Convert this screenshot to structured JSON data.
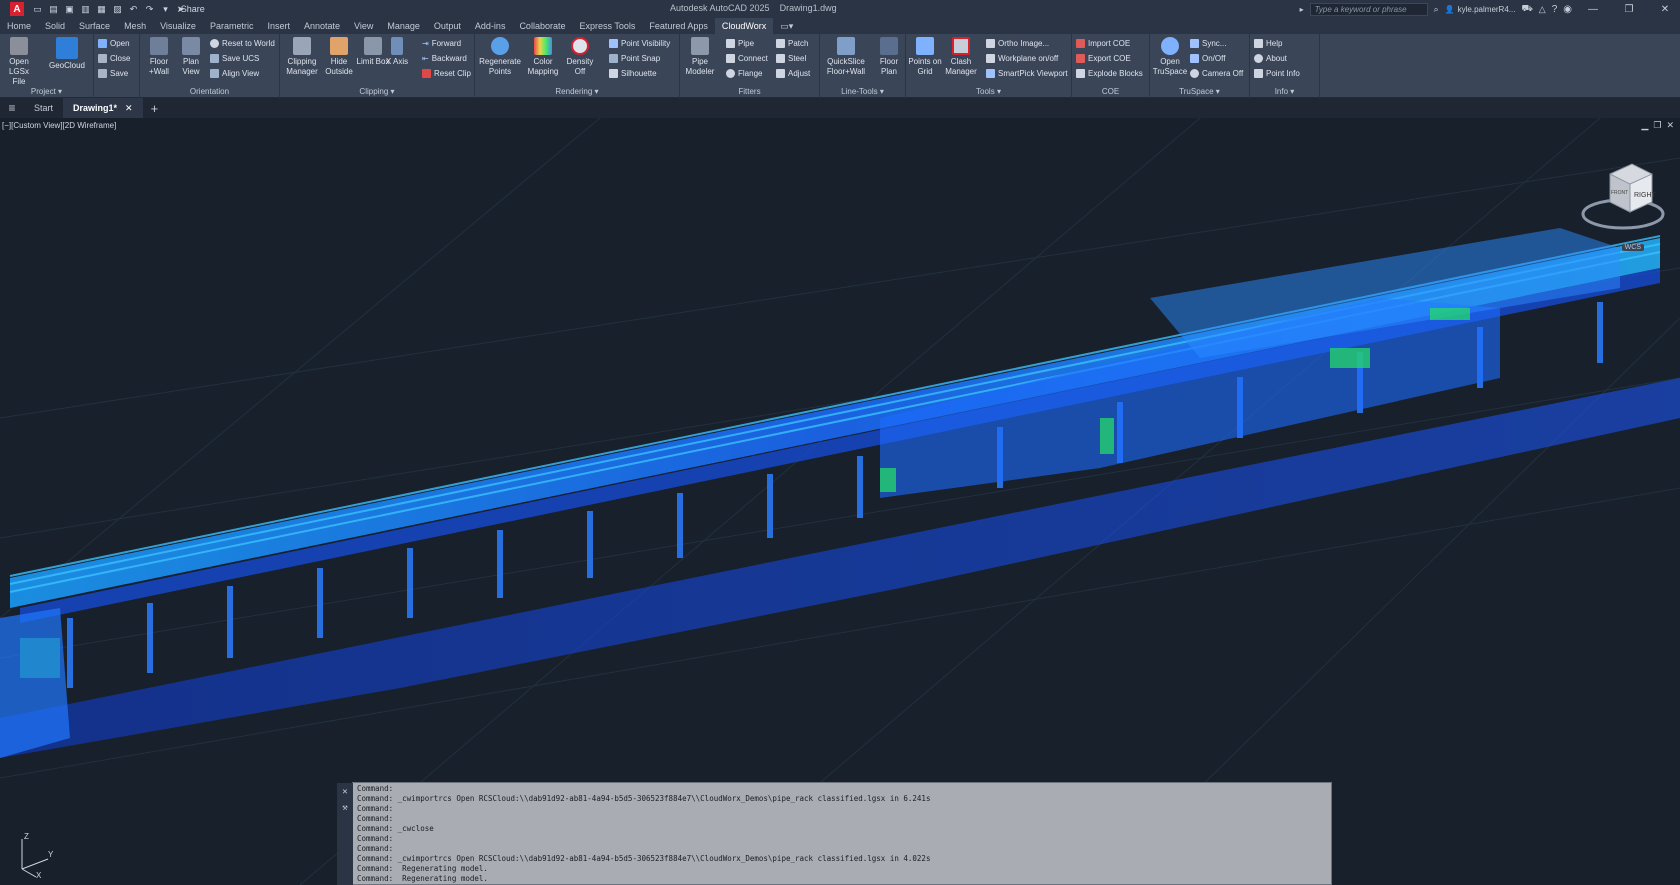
{
  "window": {
    "app_title": "Autodesk AutoCAD 2025",
    "doc_title": "Drawing1.dwg",
    "share_label": "Share",
    "search_placeholder": "Type a keyword or phrase",
    "user": "kyle.palmerR4...",
    "logo_letter": "A"
  },
  "menu_tabs": [
    "Home",
    "Solid",
    "Surface",
    "Mesh",
    "Visualize",
    "Parametric",
    "Insert",
    "Annotate",
    "View",
    "Manage",
    "Output",
    "Add-ins",
    "Collaborate",
    "Express Tools",
    "Featured Apps",
    "CloudWorx"
  ],
  "active_menu_tab": "CloudWorx",
  "ribbon": {
    "project": {
      "title": "Project",
      "open_lgsx": "Open LGSx File",
      "geocloud": "GeoCloud",
      "open": "Open",
      "close": "Close",
      "save": "Save"
    },
    "orientation": {
      "title": "Orientation",
      "floor_wall": "Floor +Wall",
      "plan_view": "Plan View",
      "reset_world": "Reset to World",
      "save_ucs": "Save UCS",
      "align_view": "Align View"
    },
    "clipping": {
      "title": "Clipping",
      "clipping_manager": "Clipping Manager",
      "hide_outside": "Hide Outside",
      "limit_box": "Limit Box",
      "x_axis": "X Axis",
      "forward": "Forward",
      "backward": "Backward",
      "reset_clip": "Reset Clip"
    },
    "rendering": {
      "title": "Rendering",
      "regenerate_points": "Regenerate Points",
      "color_mapping": "Color Mapping",
      "density_off": "Density Off",
      "point_visibility": "Point Visibility",
      "point_snap": "Point Snap",
      "silhouette": "Silhouette"
    },
    "fitters": {
      "title": "Fitters",
      "pipe_modeler": "Pipe Modeler",
      "pipe": "Pipe",
      "connect": "Connect",
      "flange": "Flange",
      "patch": "Patch",
      "steel": "Steel",
      "adjust": "Adjust"
    },
    "line_tools": {
      "title": "Line-Tools",
      "quickslice": "QuickSlice Floor+Wall",
      "floor_plan": "Floor Plan"
    },
    "tools": {
      "title": "Tools",
      "points_on_grid": "Points on Grid",
      "clash_manager": "Clash Manager",
      "ortho_image": "Ortho Image...",
      "workplane": "Workplane on/off",
      "smartpick": "SmartPick Viewport"
    },
    "coe": {
      "title": "COE",
      "import_coe": "Import COE",
      "export_coe": "Export COE",
      "explode_blocks": "Explode Blocks"
    },
    "truspace": {
      "title": "TruSpace",
      "open_truspace": "Open TruSpace",
      "sync": "Sync...",
      "on_off": "On/Off",
      "camera_off": "Camera Off"
    },
    "info": {
      "title": "Info",
      "help": "Help",
      "about": "About",
      "point_info": "Point Info"
    }
  },
  "file_tabs": {
    "start": "Start",
    "drawing": "Drawing1*"
  },
  "viewport": {
    "label": "[−][Custom View][2D Wireframe]",
    "viewcube_face": "RIGHT",
    "viewcube_front": "FRONT",
    "wcs": "WCS",
    "ucs_x": "X",
    "ucs_y": "Y",
    "ucs_z": "Z"
  },
  "command_lines": [
    "Command:",
    "Command: _cwimportrcs Open RCSCloud:\\\\dab91d92-ab81-4a94-b5d5-306523f884e7\\\\CloudWorx_Demos\\pipe_rack classified.lgsx in 6.241s",
    "Command:",
    "Command:",
    "Command: _cwclose",
    "Command:",
    "Command:",
    "Command: _cwimportrcs Open RCSCloud:\\\\dab91d92-ab81-4a94-b5d5-306523f884e7\\\\CloudWorx_Demos\\pipe_rack classified.lgsx in 4.022s",
    "Command:  Regenerating model.",
    "Command:  Regenerating model."
  ],
  "colors": {
    "point_cloud_primary": "#1a6bff",
    "point_cloud_highlight": "#26d96b",
    "background": "#18202c"
  }
}
